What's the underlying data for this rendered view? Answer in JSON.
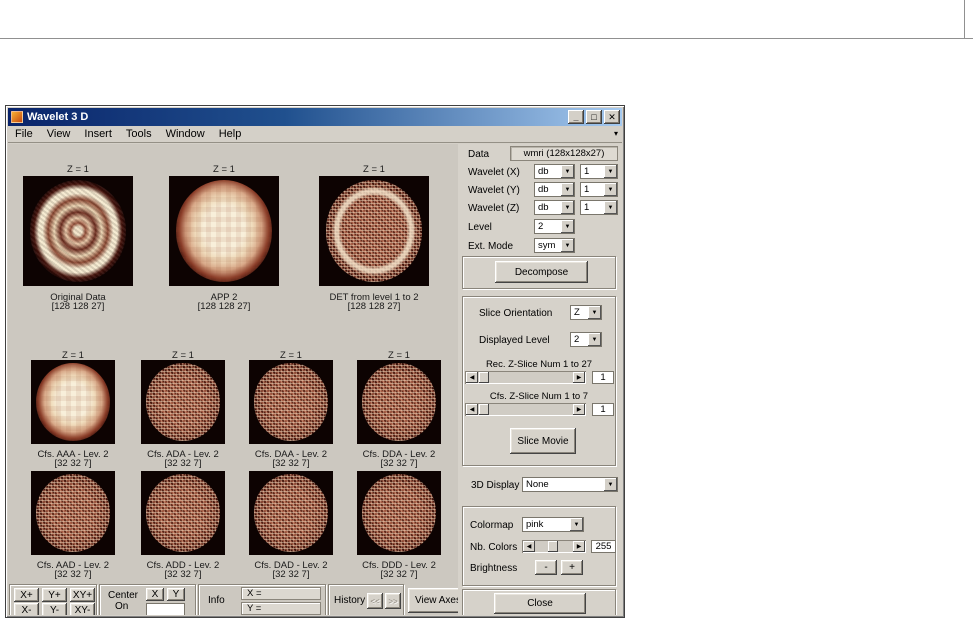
{
  "window": {
    "title": "Wavelet 3 D",
    "menu": [
      "File",
      "View",
      "Insert",
      "Tools",
      "Window",
      "Help"
    ]
  },
  "icons": {
    "minimize": "_",
    "maximize": "□",
    "close": "✕",
    "down": "▼",
    "left": "◀",
    "right": "▶",
    "dock": "▾",
    "history_prev": "<<",
    "history_next": ">>"
  },
  "plots": {
    "row1": [
      {
        "z": "Z = 1",
        "caption": "Original Data",
        "dims": "[128 128 27]"
      },
      {
        "z": "Z = 1",
        "caption": "APP 2",
        "dims": "[128 128 27]"
      },
      {
        "z": "Z = 1",
        "caption": "DET from level 1 to 2",
        "dims": "[128 128 27]"
      }
    ],
    "row2": [
      {
        "z": "Z = 1",
        "caption": "Cfs. AAA - Lev. 2",
        "dims": "[32 32 7]"
      },
      {
        "z": "Z = 1",
        "caption": "Cfs. ADA - Lev. 2",
        "dims": "[32 32 7]"
      },
      {
        "z": "Z = 1",
        "caption": "Cfs. DAA - Lev. 2",
        "dims": "[32 32 7]"
      },
      {
        "z": "Z = 1",
        "caption": "Cfs. DDA - Lev. 2",
        "dims": "[32 32 7]"
      }
    ],
    "row3": [
      {
        "caption": "Cfs. AAD - Lev. 2",
        "dims": "[32 32 7]"
      },
      {
        "caption": "Cfs. ADD - Lev. 2",
        "dims": "[32 32 7]"
      },
      {
        "caption": "Cfs. DAD - Lev. 2",
        "dims": "[32 32 7]"
      },
      {
        "caption": "Cfs. DDD - Lev. 2",
        "dims": "[32 32 7]"
      }
    ]
  },
  "panel": {
    "data_label": "Data",
    "data_value": "wmri (128x128x27)",
    "wavelet_rows": [
      {
        "label": "Wavelet (X)",
        "family": "db",
        "num": "1"
      },
      {
        "label": "Wavelet (Y)",
        "family": "db",
        "num": "1"
      },
      {
        "label": "Wavelet (Z)",
        "family": "db",
        "num": "1"
      }
    ],
    "level_label": "Level",
    "level_value": "2",
    "ext_mode_label": "Ext. Mode",
    "ext_mode_value": "sym",
    "decompose_label": "Decompose",
    "slice_orientation_label": "Slice Orientation",
    "slice_orientation_value": "Z",
    "displayed_level_label": "Displayed Level",
    "displayed_level_value": "2",
    "rec_slider_label": "Rec. Z-Slice Num 1 to 27",
    "rec_slider_value": "1",
    "cfs_slider_label": "Cfs. Z-Slice Num 1 to 7",
    "cfs_slider_value": "1",
    "slice_movie_label": "Slice Movie",
    "display3d_label": "3D Display",
    "display3d_value": "None",
    "colormap_label": "Colormap",
    "colormap_value": "pink",
    "nb_colors_label": "Nb. Colors",
    "nb_colors_value": "255",
    "brightness_label": "Brightness",
    "brightness_minus": "-",
    "brightness_plus": "+",
    "close_label": "Close"
  },
  "bottom": {
    "zoom_buttons": [
      "X+",
      "Y+",
      "XY+",
      "X-",
      "Y-",
      "XY-"
    ],
    "center_line1": "Center",
    "center_line2": "On",
    "center_x": "X",
    "center_y": "Y",
    "center_value": "",
    "info_label": "Info",
    "info_x": "X =",
    "info_y": "Y =",
    "history_label": "History",
    "view_axes_label": "View Axes"
  }
}
